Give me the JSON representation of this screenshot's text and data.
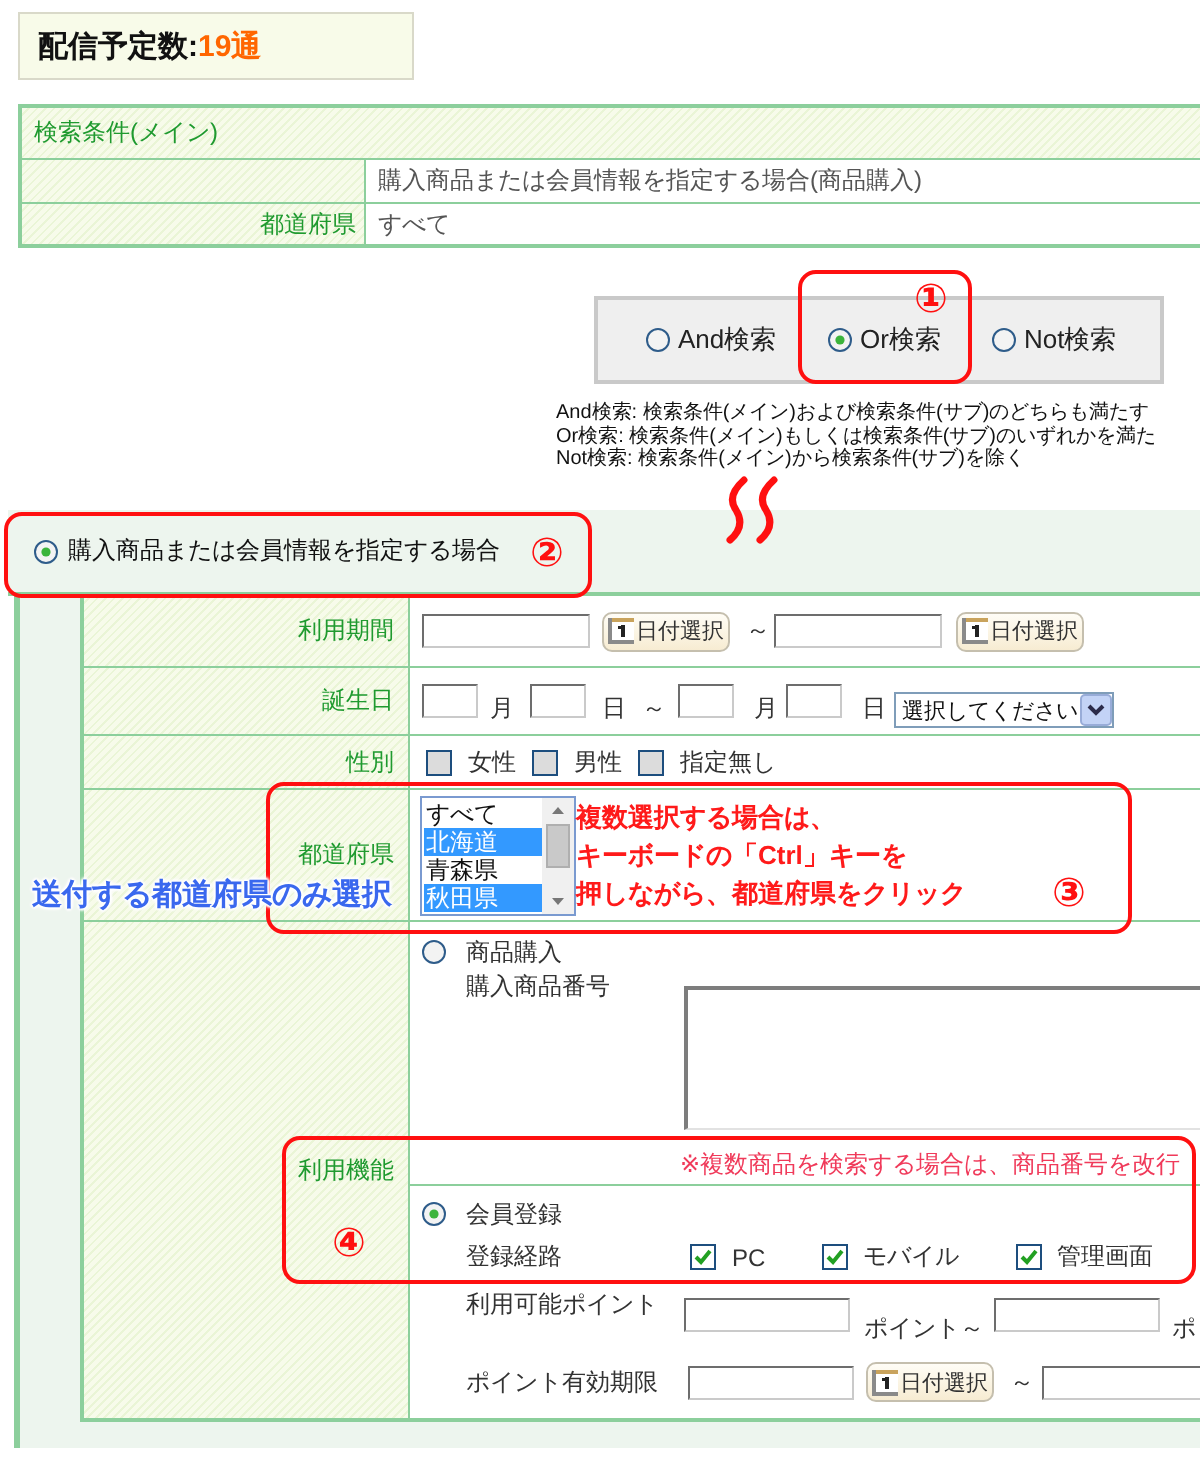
{
  "delivery_count": {
    "label": "配信予定数:",
    "value": "19通"
  },
  "main_conditions": {
    "title": "検索条件(メイン)",
    "rows": [
      {
        "value": "購入商品または会員情報を指定する場合(商品購入)"
      },
      {
        "label": "都道府県",
        "value": "すべて"
      }
    ]
  },
  "search_modes": [
    {
      "label": "And検索",
      "selected": false
    },
    {
      "label": "Or検索",
      "selected": true
    },
    {
      "label": "Not検索",
      "selected": false
    }
  ],
  "mode_descriptions": [
    "And検索: 検索条件(メイン)および検索条件(サブ)のどちらも満たす",
    "Or検索: 検索条件(メイン)もしくは検索条件(サブ)のいずれかを満た",
    "Not検索: 検索条件(メイン)から検索条件(サブ)を除く"
  ],
  "sub_condition": {
    "option": {
      "label": "購入商品または会員情報を指定する場合",
      "selected": true
    },
    "rows": [
      {
        "kind": "date_range",
        "label": "利用期間",
        "start_button": "日付選択",
        "separator": "～",
        "end_button": "日付選択"
      },
      {
        "kind": "birthday",
        "label": "誕生日",
        "from": {
          "month_unit": "月",
          "day_unit": "日"
        },
        "separator": "～",
        "to": {
          "month_unit": "月",
          "day_unit": "日"
        },
        "select": "選択してください"
      },
      {
        "kind": "checkboxes",
        "label": "性別",
        "options": [
          {
            "label": "女性",
            "checked": false
          },
          {
            "label": "男性",
            "checked": false
          },
          {
            "label": "指定無し",
            "checked": false
          }
        ]
      },
      {
        "kind": "listbox",
        "label": "都道府県",
        "options": [
          {
            "label": "すべて",
            "selected": false
          },
          {
            "label": "北海道",
            "selected": true
          },
          {
            "label": "青森県",
            "selected": false
          },
          {
            "label": "秋田県",
            "selected": true
          }
        ]
      },
      {
        "kind": "usage",
        "label": "利用機能",
        "purchase": {
          "label": "商品購入",
          "selected": false,
          "number_label": "購入商品番号",
          "note": "※複数商品を検索する場合は、商品番号を改行"
        },
        "member": {
          "label": "会員登録",
          "selected": true,
          "route_label": "登録経路",
          "routes": [
            {
              "label": "PC",
              "checked": true
            },
            {
              "label": "モバイル",
              "checked": true
            },
            {
              "label": "管理画面",
              "checked": true
            }
          ],
          "points": {
            "label": "利用可能ポイント",
            "from_unit": "ポイント",
            "separator": "～",
            "to_unit": "ポ"
          },
          "expiry": {
            "label": "ポイント有効期限",
            "button": "日付選択",
            "separator": "～"
          }
        }
      }
    ]
  },
  "annotations": [
    {
      "number": "①"
    },
    {
      "number": "②"
    },
    {
      "number": "③",
      "lines": [
        "複数選択する場合は、",
        "キーボードの「Ctrl」キーを",
        "押しながら、都道府県をクリック"
      ]
    },
    {
      "number": "④"
    }
  ],
  "callout": "送付する都道府県のみ選択"
}
